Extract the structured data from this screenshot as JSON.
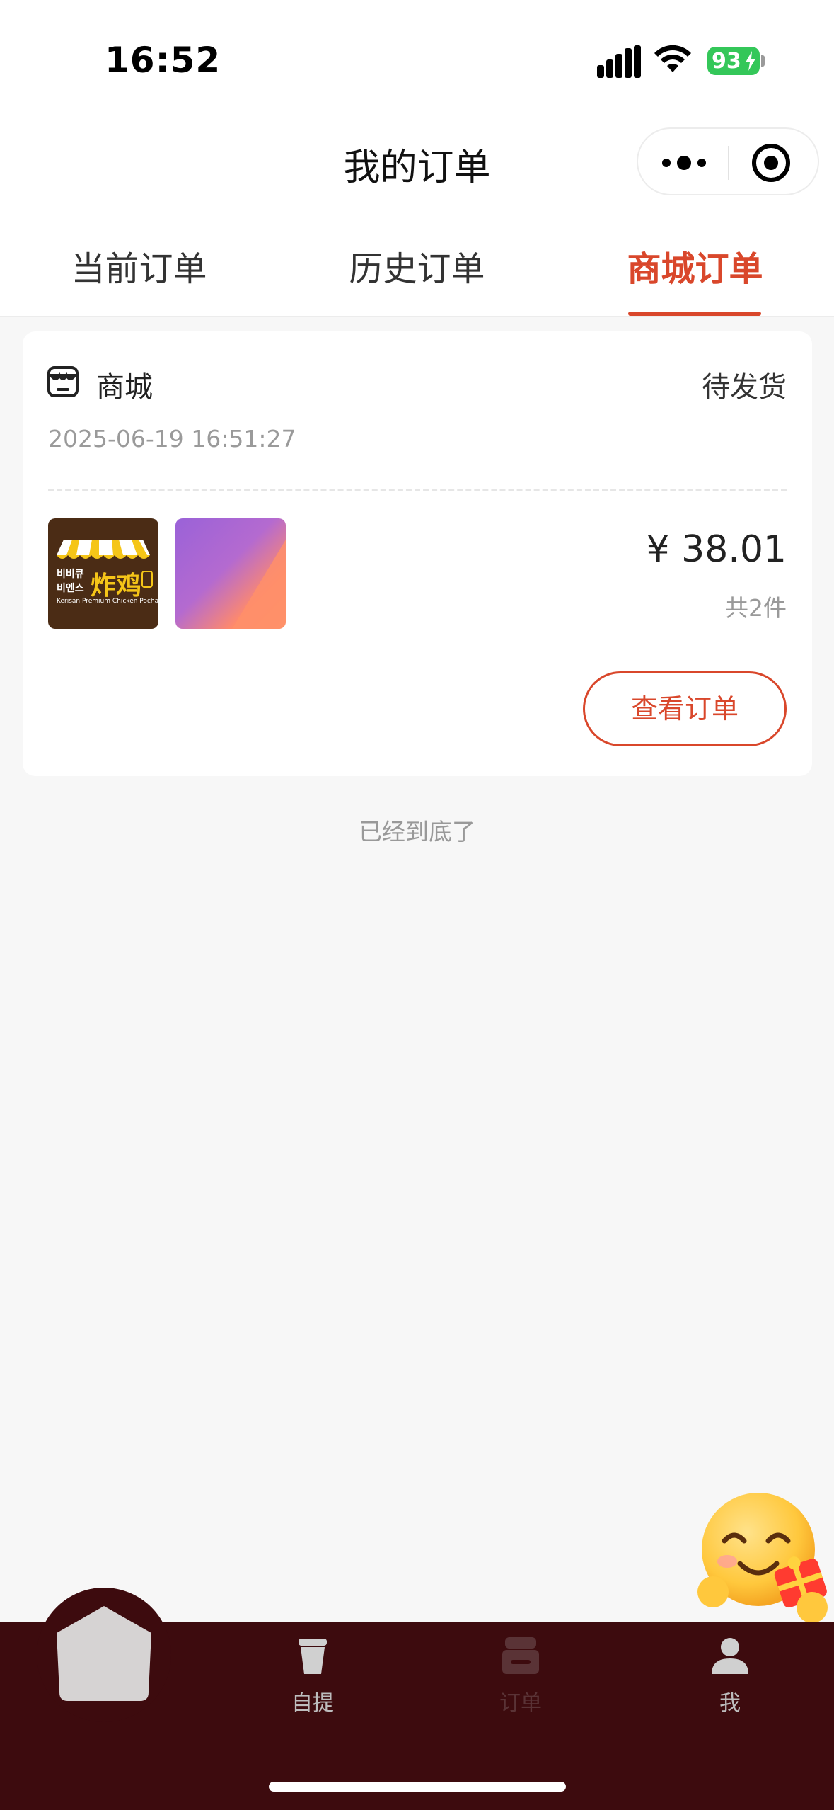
{
  "status_bar": {
    "time": "16:52",
    "battery_level": "93",
    "icons": [
      "signal-icon",
      "wifi-icon",
      "battery-icon"
    ]
  },
  "header": {
    "title": "我的订单",
    "capsule_icons": [
      "more-icon",
      "close-target-icon"
    ]
  },
  "tabs": [
    {
      "label": "当前订单",
      "active": false
    },
    {
      "label": "历史订单",
      "active": false
    },
    {
      "label": "商城订单",
      "active": true
    }
  ],
  "order": {
    "shop_icon": "shop-icon",
    "shop_name": "商城",
    "status": "待发货",
    "time": "2025-06-19 16:51:27",
    "thumbnails": [
      {
        "name": "fried-chicken-logo",
        "logo_line1": "비비큐",
        "logo_line2": "비엔스",
        "logo_cn": "炸鸡",
        "logo_en": "Kerisan Premium Chicken Pocha"
      },
      {
        "name": "gradient-product-image"
      }
    ],
    "price": "¥ 38.01",
    "count": "共2件",
    "view_button": "查看订单"
  },
  "end_hint": "已经到底了",
  "floating_emoji_icon": "smile-gift-icon",
  "tabbar": {
    "home_icon": "home-icon",
    "items": [
      {
        "label": "自提",
        "icon": "cup-icon"
      },
      {
        "label": "订单",
        "icon": "order-icon",
        "active": true
      },
      {
        "label": "我",
        "icon": "user-icon"
      }
    ]
  },
  "colors": {
    "accent": "#d9472b",
    "tabbar_bg": "#3d0b0e",
    "page_bg": "#f7f7f7"
  }
}
